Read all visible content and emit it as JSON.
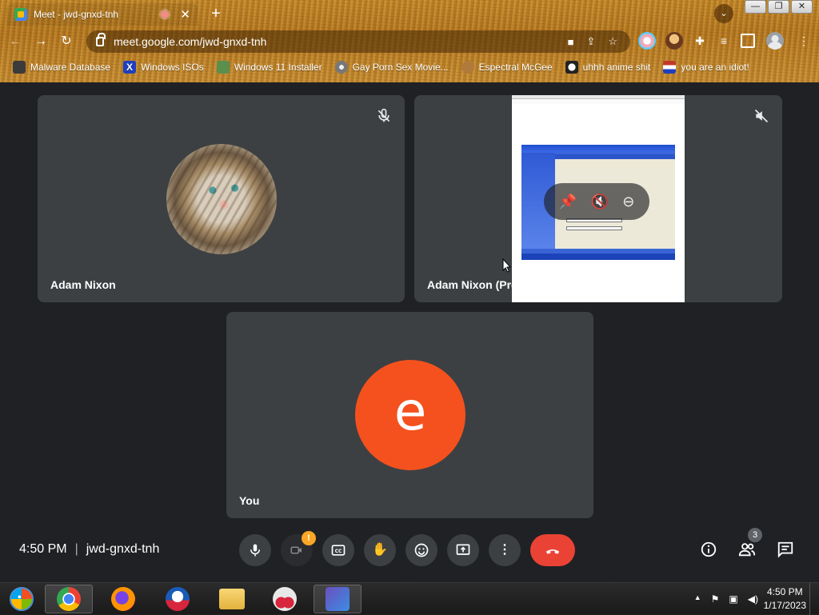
{
  "browser": {
    "tab_title": "Meet - jwd-gnxd-tnh",
    "tab_close": "✕",
    "new_tab": "+",
    "url": "meet.google.com/jwd-gnxd-tnh",
    "window_buttons": {
      "minimize": "—",
      "restore": "❐",
      "close": "✕"
    }
  },
  "bookmarks": [
    {
      "label": "Malware Database",
      "icon": "skull-icon",
      "color": "#3b3b3b"
    },
    {
      "label": "Windows ISOs",
      "icon": "x-icon",
      "color": "#1e3fbf"
    },
    {
      "label": "Windows 11 Installer",
      "icon": "installer-icon",
      "color": "#5a8f4e"
    },
    {
      "label": "Gay Porn Sex Movie...",
      "icon": "disc-icon",
      "color": "#777777"
    },
    {
      "label": "Espectral McGee",
      "icon": "face-icon",
      "color": "#b07a3a"
    },
    {
      "label": "uhhh anime shit",
      "icon": "anime-icon",
      "color": "#222222"
    },
    {
      "label": "you are an idiot!",
      "icon": "flag-icon",
      "color": "#c0392b"
    }
  ],
  "tiles": [
    {
      "name": "Adam Nixon"
    },
    {
      "name": "Adam Nixon (Presentation)"
    },
    {
      "name": "You",
      "avatar_letter": "e",
      "avatar_color": "#f4511e"
    }
  ],
  "controls": {
    "time": "4:50 PM",
    "separator": "|",
    "meeting_code": "jwd-gnxd-tnh",
    "participant_count": "3"
  },
  "taskbar": {
    "clock_time": "4:50 PM",
    "clock_date": "1/17/2023",
    "tray_arrow": "▲"
  },
  "colors": {
    "end_call": "#ea4335",
    "avatar": "#f4511e",
    "tile_bg": "#3c4043",
    "page_bg": "#202124"
  }
}
